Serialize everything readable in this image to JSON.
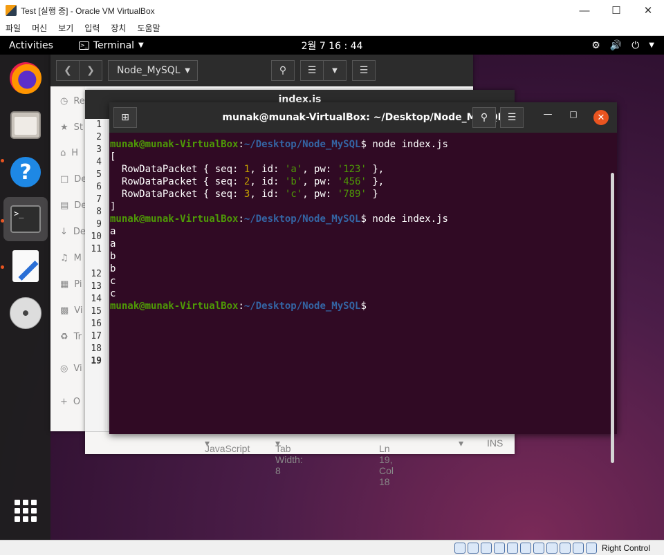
{
  "vbox": {
    "title": "Test [실행 중] - Oracle VM VirtualBox",
    "menu": [
      "파일",
      "머신",
      "보기",
      "입력",
      "장치",
      "도움말"
    ],
    "status_right": "Right Control"
  },
  "topbar": {
    "activities": "Activities",
    "app": "Terminal",
    "clock": "2월 7  16 : 44"
  },
  "files": {
    "path": "Node_MySQL",
    "sidebar": [
      "Re",
      "St",
      "H",
      "De",
      "De",
      "De",
      "M",
      "Pi",
      "Vi",
      "Tr",
      "Vi",
      "O"
    ]
  },
  "gedit": {
    "title": "index.js",
    "line_numbers": [
      "1",
      "2",
      "3",
      "4",
      "5",
      "6",
      "7",
      "8",
      "9",
      "10",
      "11",
      "",
      "12",
      "13",
      "14",
      "15",
      "16",
      "17",
      "18",
      "19"
    ],
    "language": "JavaScript",
    "tab_width": "Tab Width: 8",
    "position": "Ln 19, Col 18",
    "mode": "INS"
  },
  "terminal": {
    "title": "munak@munak-VirtualBox: ~/Desktop/Node_MySQL",
    "user_host": "munak@munak-VirtualBox",
    "path": "~/Desktop/Node_MySQL",
    "command": "node index.js",
    "rows": [
      {
        "seq": "1",
        "id": "'a'",
        "pw": "'123'",
        "end": " },"
      },
      {
        "seq": "2",
        "id": "'b'",
        "pw": "'456'",
        "end": " },"
      },
      {
        "seq": "3",
        "id": "'c'",
        "pw": "'789'",
        "end": " }"
      }
    ],
    "output2": [
      "a",
      "a",
      "b",
      "b",
      "c",
      "c"
    ]
  }
}
